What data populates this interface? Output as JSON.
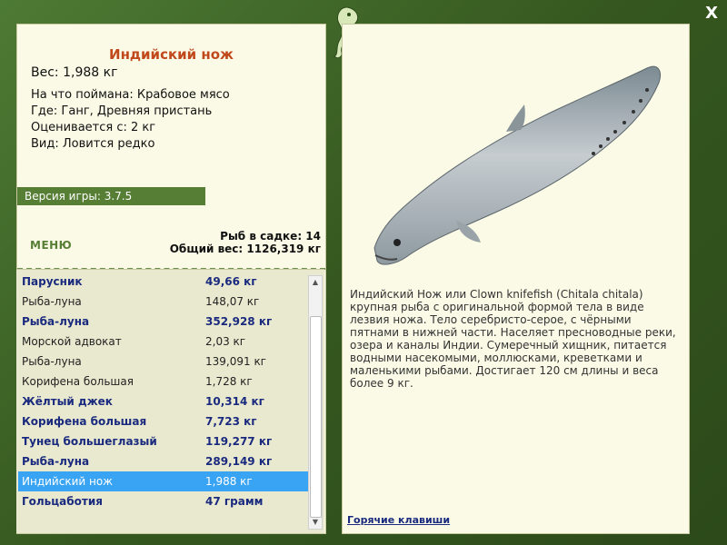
{
  "window": {
    "close_label": "X"
  },
  "fish": {
    "title": "Индийский нож",
    "weight": "Вес: 1,988 кг",
    "caught_on": "На что поймана: Крабовое мясо",
    "where": "Где: Ганг, Древняя пристань",
    "value": "Оценивается с: 2 кг",
    "kind": "Вид: Ловится редко"
  },
  "version": "Версия игры: 3.7.5",
  "menu_label": "МЕНЮ",
  "cage": {
    "count": "Рыб в садке: 14",
    "total": "Общий вес: 1126,319 кг"
  },
  "catch_list": [
    {
      "name": "Парусник",
      "weight": "49,66 кг",
      "style": "bold"
    },
    {
      "name": "Рыба-луна",
      "weight": "148,07 кг",
      "style": "normal"
    },
    {
      "name": "Рыба-луна",
      "weight": "352,928 кг",
      "style": "bold"
    },
    {
      "name": "Морской адвокат",
      "weight": "2,03 кг",
      "style": "normal"
    },
    {
      "name": "Рыба-луна",
      "weight": "139,091 кг",
      "style": "normal"
    },
    {
      "name": "Корифена большая",
      "weight": "1,728 кг",
      "style": "normal"
    },
    {
      "name": "Жёлтый джек",
      "weight": "10,314 кг",
      "style": "bold"
    },
    {
      "name": "Корифена большая",
      "weight": "7,723 кг",
      "style": "bold"
    },
    {
      "name": "Тунец большеглазый",
      "weight": "119,277 кг",
      "style": "bold"
    },
    {
      "name": "Рыба-луна",
      "weight": "289,149 кг",
      "style": "bold"
    },
    {
      "name": "Индийский нож",
      "weight": "1,988 кг",
      "style": "selected"
    },
    {
      "name": "Гольцаботия",
      "weight": "47 грамм",
      "style": "bold"
    }
  ],
  "description": "Индийский Нож или Clown knifefish (Chitala chitala) крупная рыба с оригинальной формой тела в виде лезвия ножа. Тело серебристо-серое, с чёрными пятнами в нижней части. Населяет пресноводные реки, озера и каналы Индии. Сумеречный хищник, питается водными насекомыми, моллюсками, креветками и маленькими рыбами. Достигает 120 см длины и веса более 9 кг.",
  "hotkeys_label": "Горячие клавиши",
  "colors": {
    "accent": "#567e34",
    "title": "#c0481a",
    "link": "#1a2a7e",
    "selection": "#39a4f4"
  },
  "icons": {
    "close": "close-icon",
    "logo": "seahorse-logo-icon",
    "scroll_up": "scroll-up-icon",
    "scroll_down": "scroll-down-icon"
  }
}
